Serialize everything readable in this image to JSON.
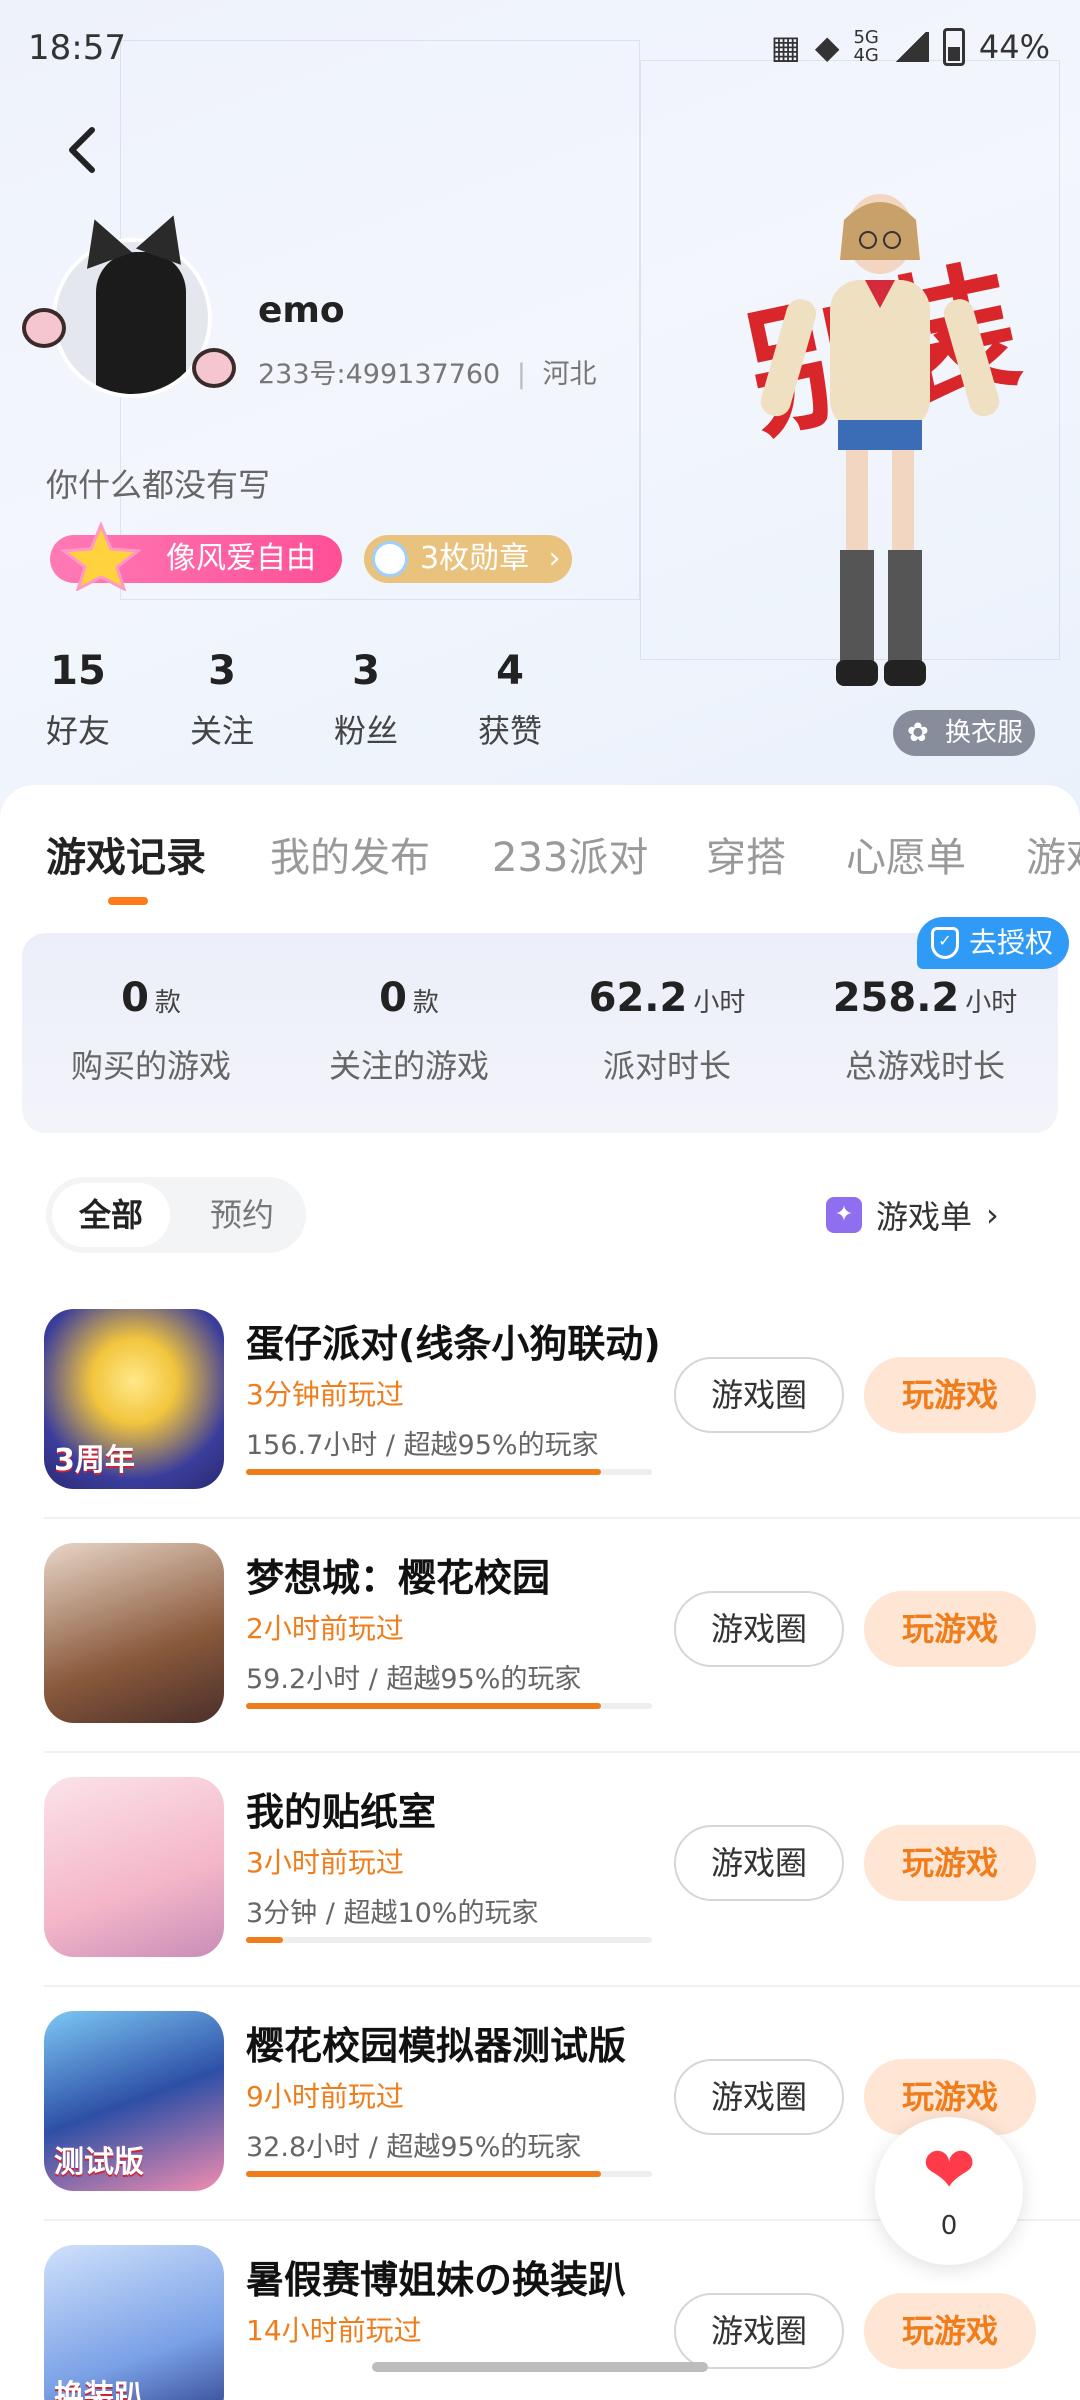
{
  "status_bar": {
    "time": "18:57",
    "network": "5G",
    "network2": "4G",
    "battery": "44%"
  },
  "profile": {
    "name": "emo",
    "id_line": "233号:499137760",
    "region": "河北",
    "bio": "你什么都没有写",
    "tag_name": "像风爱自由",
    "medal_label": "3枚勋章",
    "calligraphy": "别装",
    "dress_label": "换衣服",
    "stats": [
      {
        "value": "15",
        "label": "好友"
      },
      {
        "value": "3",
        "label": "关注"
      },
      {
        "value": "3",
        "label": "粉丝"
      },
      {
        "value": "4",
        "label": "获赞"
      }
    ]
  },
  "tabs": [
    "游戏记录",
    "我的发布",
    "233派对",
    "穿搭",
    "心愿单",
    "游戏"
  ],
  "summary": {
    "auth_label": "去授权",
    "items": [
      {
        "value": "0",
        "unit": "款",
        "label": "购买的游戏"
      },
      {
        "value": "0",
        "unit": "款",
        "label": "关注的游戏"
      },
      {
        "value": "62.2",
        "unit": "小时",
        "label": "派对时长"
      },
      {
        "value": "258.2",
        "unit": "小时",
        "label": "总游戏时长"
      }
    ]
  },
  "filter": {
    "all": "全部",
    "reserve": "预约",
    "gamelist": "游戏单"
  },
  "game_buttons": {
    "circle": "游戏圈",
    "play": "玩游戏"
  },
  "games": [
    {
      "title": "蛋仔派对(线条小狗联动)",
      "recent": "3分钟前玩过",
      "stat": "156.7小时 / 超越95%的玩家",
      "progress": 0.95,
      "icon_label": "3周年"
    },
    {
      "title": "梦想城：樱花校园",
      "recent": "2小时前玩过",
      "stat": "59.2小时 / 超越95%的玩家",
      "progress": 0.95,
      "icon_label": ""
    },
    {
      "title": "我的贴纸室",
      "recent": "3小时前玩过",
      "stat": "3分钟 / 超越10%的玩家",
      "progress": 0.1,
      "icon_label": ""
    },
    {
      "title": "樱花校园模拟器测试版",
      "recent": "9小时前玩过",
      "stat": "32.8小时 / 超越95%的玩家",
      "progress": 0.95,
      "icon_label": "测试版"
    },
    {
      "title": "暑假赛博姐妹の换装趴",
      "recent": "14小时前玩过",
      "stat": "",
      "progress": 0,
      "icon_label": "换装趴"
    }
  ],
  "like": {
    "count": "0"
  },
  "colors": {
    "accent": "#f07d1c",
    "pink_tag": "#ff4f96",
    "medal_gold": "#e9c27e",
    "auth_blue": "#2f9bf6"
  }
}
